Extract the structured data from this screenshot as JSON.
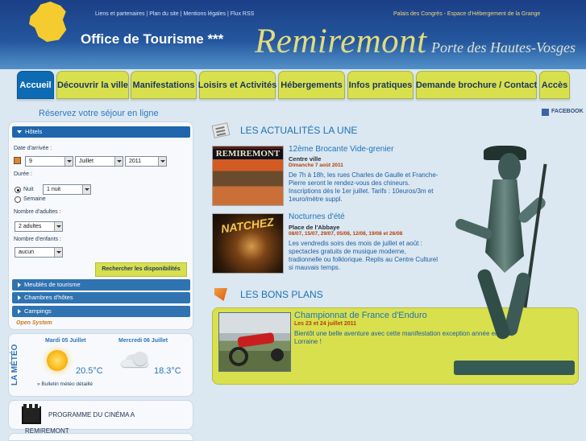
{
  "header": {
    "top_links": "Liens et partenaires | Plan du site | Mentions légales | Flux RSS",
    "top_right": "Palais des Congrès - Espace d'Hébergement de la Grange",
    "office_title": "Office de Tourisme ***",
    "brand": "Remiremont",
    "tagline": "Porte des Hautes-Vosges"
  },
  "nav": [
    {
      "label": "Accueil"
    },
    {
      "label": "Découvrir la ville"
    },
    {
      "label": "Manifestations"
    },
    {
      "label": "Loisirs et Activités"
    },
    {
      "label": "Hébergements"
    },
    {
      "label": "Infos pratiques"
    },
    {
      "label": "Demande brochure / Contact"
    },
    {
      "label": "Accès"
    }
  ],
  "booking": {
    "title": "Réservez votre séjour en ligne",
    "hotels": "Hôtels",
    "arrival_label": "Date d'arrivée :",
    "day": "9",
    "month": "Juillet",
    "year": "2011",
    "duration_label": "Durée :",
    "night_label": "Nuit",
    "week_label": "Semaine",
    "nights_value": "1 nuit",
    "adults_label": "Nombre d'adultes :",
    "adults_value": "2 adultes",
    "children_label": "Nombre d'enfants :",
    "children_value": "aucun",
    "search_button": "Rechercher les disponibilités",
    "rentals": "Meublés de tourisme",
    "guest_rooms": "Chambres d'hôtes",
    "campings": "Campings",
    "open_system": "Open System"
  },
  "weather": {
    "vertical_title": "LA MÉTÉO",
    "day1": "Mardi 05 Juillet",
    "temp1": "20.5°C",
    "day2": "Mercredi 06 Juillet",
    "temp2": "18.3°C",
    "bulletin": "» Bulletin météo détaillé"
  },
  "cinema": {
    "line1": "PROGRAMME DU CINÉMA A",
    "line2": "REMIREMONT"
  },
  "facebook": "FACEBOOK",
  "news_head": "LES ACTUALITÉS LA UNE",
  "news": [
    {
      "thumb_title": "REMIREMONT",
      "title": "12ème Brocante Vide-grenier",
      "place": "Centre ville",
      "date": "Dimanche 7 août 2011",
      "text": "De 7h à 18h, les rues Charles de Gaulle et Franche-Pierre seront le rendez-vous des chineurs. Inscriptions dès le 1er juillet. Tarifs : 10euros/3m et 1euro/mètre suppl."
    },
    {
      "thumb_title": "NATCHEZ",
      "title": "Nocturnes d'été",
      "place": "Place de l'Abbaye",
      "date": "08/07, 15/07, 29/07, 05/08, 12/08, 19/08 et 26/08",
      "text": "Les vendredis soirs des mois de juillet et août : spectacles gratuits de musique moderne, tradionnelle ou folklorique. Replis au Centre Culturel si mauvais temps."
    }
  ],
  "plans_head": "LES BONS PLANS",
  "plan": {
    "title": "Championnat de France d'Enduro",
    "date": "Les 23 et 24 juillet 2011",
    "text": "Bientôt une belle aventure avec cette manifestation exception année en Lorraine !"
  }
}
